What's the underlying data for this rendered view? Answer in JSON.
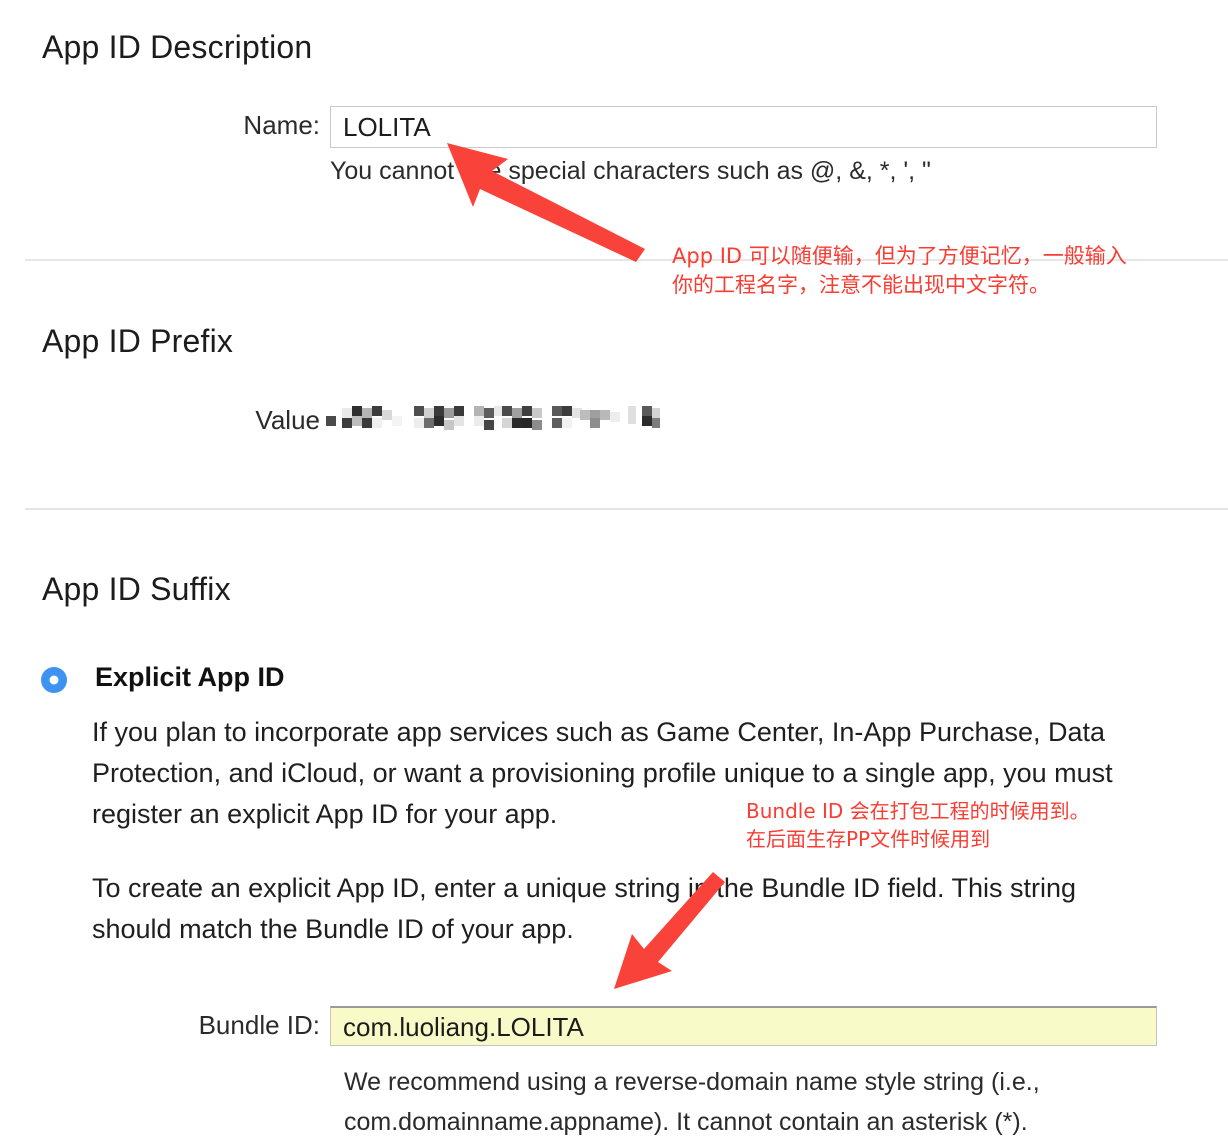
{
  "sections": {
    "description": {
      "heading": "App ID Description",
      "name_label": "Name:",
      "name_value": "LOLITA",
      "name_help": "You cannot use special characters such as @, &, *, ', \""
    },
    "prefix": {
      "heading": "App ID Prefix",
      "value_label": "Value",
      "value_redacted": "••••••••••••••••••••"
    },
    "suffix": {
      "heading": "App ID Suffix",
      "explicit_option_label": "Explicit App ID",
      "paragraph1_line1": "If you plan to incorporate app services such as Game Center, In-App Purchase, Data",
      "paragraph1_line2": "Protection, and iCloud, or want a provisioning profile unique to a single app, you must",
      "paragraph1_line3": "register an explicit App ID for your app.",
      "paragraph2_line1": "To create an explicit App ID, enter a unique string in the Bundle ID field. This string",
      "paragraph2_line2": "should match the Bundle ID of your app.",
      "bundle_label": "Bundle ID:",
      "bundle_value": "com.luoliang.LOLITA",
      "bundle_help_line1": "We recommend using a reverse-domain name style string (i.e.,",
      "bundle_help_line2": "com.domainname.appname). It cannot contain an asterisk (*)."
    }
  },
  "annotations": {
    "app_id_note_line1": "App ID 可以随便输，但为了方便记忆，一般输入",
    "app_id_note_line2": "你的工程名字，注意不能出现中文字符。",
    "bundle_note_line1": "Bundle ID 会在打包工程的时候用到。",
    "bundle_note_line2": "在后面生存PP文件时候用到"
  },
  "colors": {
    "annotation_red": "#fa3c32",
    "arrow_red": "#f9423a",
    "radio_blue": "#3d93f2",
    "autofill_yellow": "#f8fbc8",
    "divider_gray": "#e6e6e6"
  }
}
